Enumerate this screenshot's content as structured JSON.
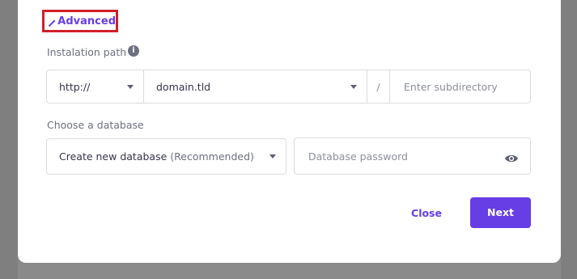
{
  "advanced": {
    "label": "Advanced"
  },
  "installation": {
    "label": "Instalation path",
    "info_icon": "info-icon",
    "protocol": "http://",
    "domain": "domain.tld",
    "separator": "/",
    "subdirectory_placeholder": "Enter subdirectory"
  },
  "database": {
    "label": "Choose a database",
    "select_value": "Create new database",
    "select_hint": "(Recommended)",
    "password_placeholder": "Database password",
    "password_toggle_icon": "eye-icon"
  },
  "actions": {
    "close_label": "Close",
    "next_label": "Next"
  },
  "colors": {
    "accent": "#673de6",
    "highlight_border": "#d0202a"
  }
}
